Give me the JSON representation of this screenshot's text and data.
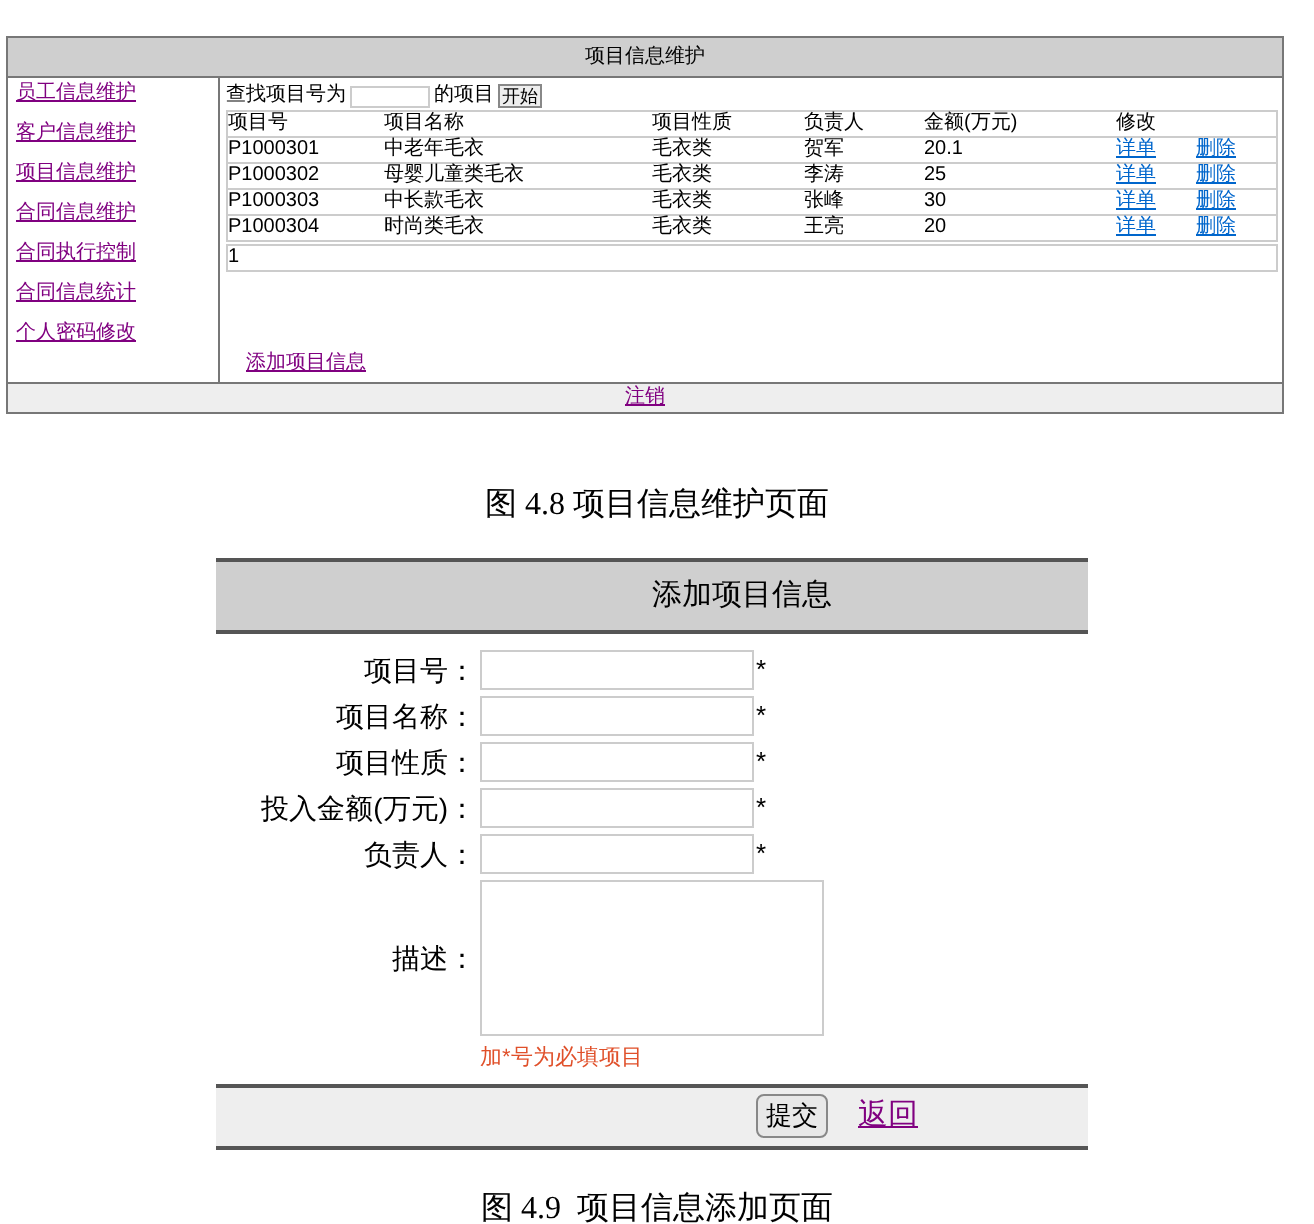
{
  "figure_1": {
    "window_title": "项目信息维护",
    "sidebar": {
      "items": [
        {
          "label": "员工信息维护"
        },
        {
          "label": "客户信息维护"
        },
        {
          "label": "项目信息维护"
        },
        {
          "label": "合同信息维护"
        },
        {
          "label": "合同执行控制"
        },
        {
          "label": "合同信息统计"
        },
        {
          "label": "个人密码修改"
        }
      ]
    },
    "search": {
      "prefix": "查找项目号为",
      "suffix": "的项目",
      "button": "开始"
    },
    "table": {
      "columns": [
        "项目号",
        "项目名称",
        "项目性质",
        "负责人",
        "金额(万元)",
        "修改"
      ],
      "rows": [
        {
          "cells": [
            "P1000301",
            "中老年毛衣",
            "毛衣类",
            "贺军",
            "20.1"
          ],
          "detail": "详单",
          "delete": "删除"
        },
        {
          "cells": [
            "P1000302",
            "母婴儿童类毛衣",
            "毛衣类",
            "李涛",
            "25"
          ],
          "detail": "详单",
          "delete": "删除"
        },
        {
          "cells": [
            "P1000303",
            "中长款毛衣",
            "毛衣类",
            "张峰",
            "30"
          ],
          "detail": "详单",
          "delete": "删除"
        },
        {
          "cells": [
            "P1000304",
            "时尚类毛衣",
            "毛衣类",
            "王亮",
            "20"
          ],
          "detail": "详单",
          "delete": "删除"
        }
      ],
      "pager": "1"
    },
    "add_link": "添加项目信息",
    "footer_link": "注销",
    "caption": "图 4.8 项目信息维护页面"
  },
  "figure_2": {
    "title": "添加项目信息",
    "fields": [
      {
        "label": "项目号：",
        "required_mark": "*"
      },
      {
        "label": "项目名称：",
        "required_mark": "*"
      },
      {
        "label": "项目性质：",
        "required_mark": "*"
      },
      {
        "label": "投入金额(万元)：",
        "required_mark": "*"
      },
      {
        "label": "负责人：",
        "required_mark": "*"
      }
    ],
    "description_label": "描述：",
    "note": "加*号为必填项目",
    "submit": "提交",
    "back_link": "返回",
    "caption": "图 4.9  项目信息添加页面"
  }
}
